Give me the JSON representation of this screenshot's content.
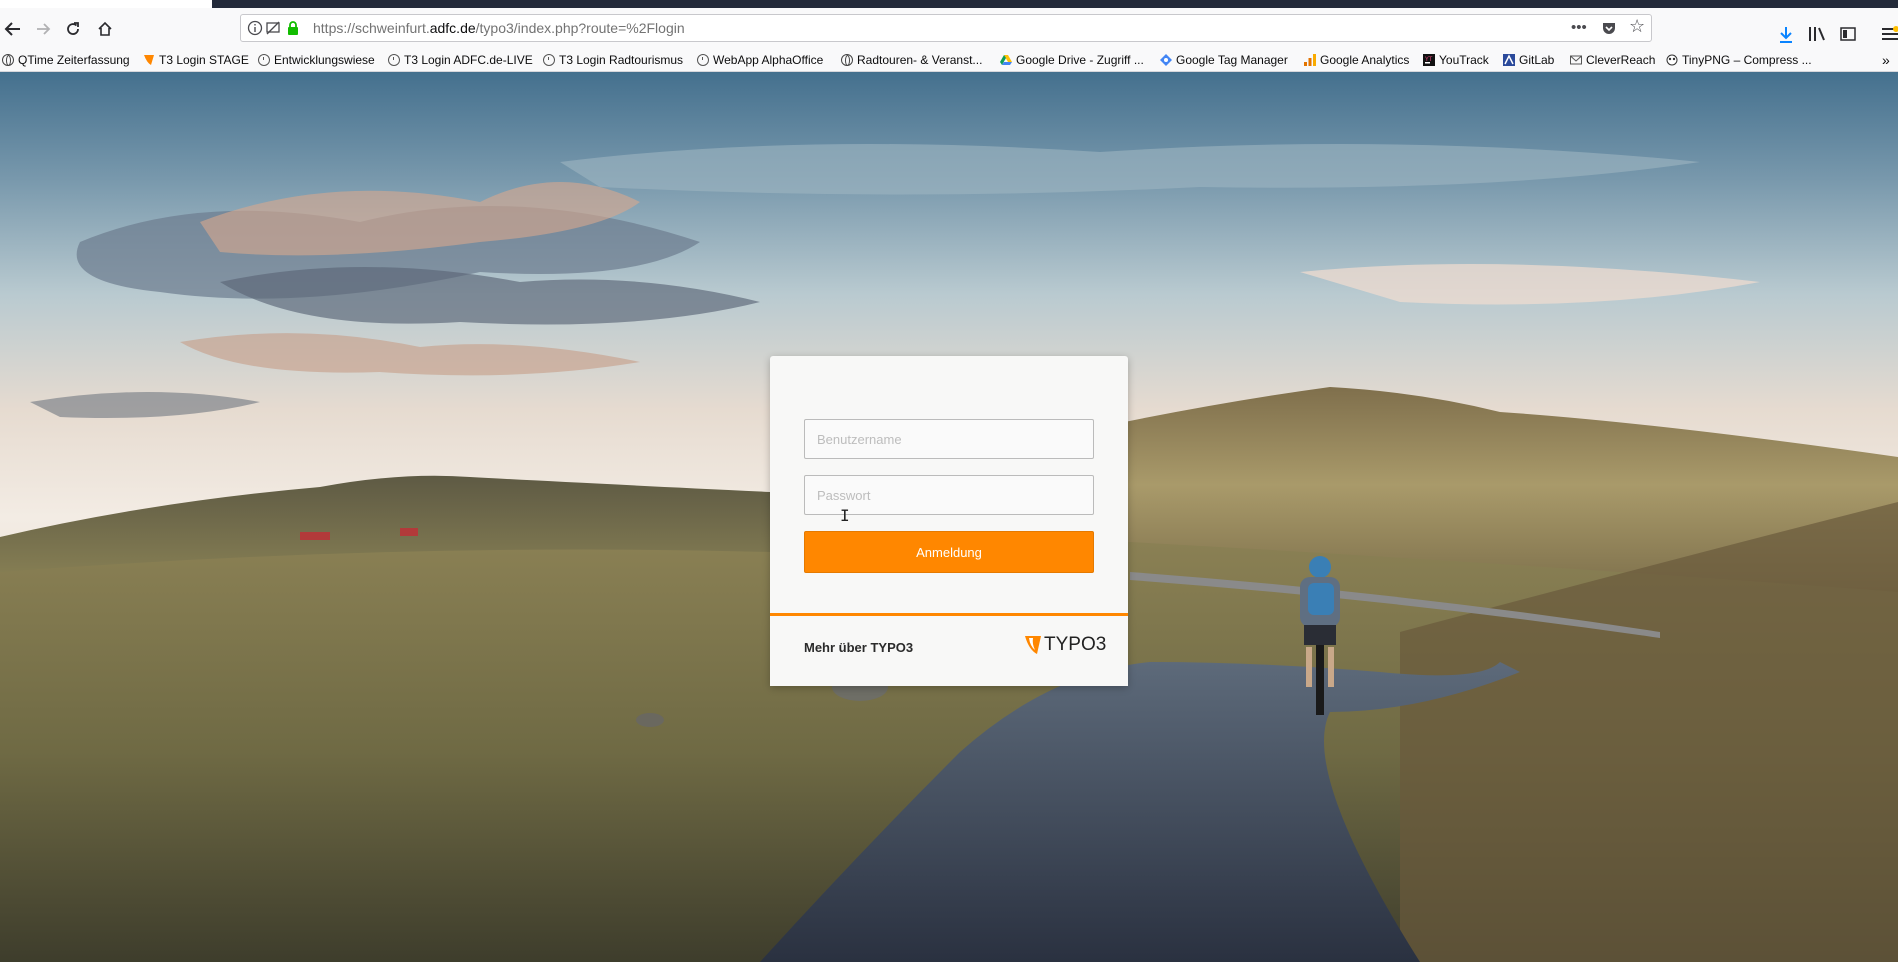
{
  "browser": {
    "url_prefix": "https://schweinfurt.",
    "url_host": "adfc.de",
    "url_path": "/typo3/index.php?route=%2Flogin",
    "more_icon": "•••",
    "pocket_icon": "pocket-icon",
    "star_icon": "☆",
    "back_icon": "back-arrow-icon",
    "forward_icon": "forward-arrow-icon",
    "reload_icon": "reload-icon",
    "home_icon": "home-icon"
  },
  "bookmarks": [
    {
      "label": "QTime Zeiterfassung",
      "icon": "globe"
    },
    {
      "label": "T3 Login STAGE",
      "icon": "typo3"
    },
    {
      "label": "Entwicklungswiese",
      "icon": "clock"
    },
    {
      "label": "T3 Login ADFC.de-LIVE",
      "icon": "clock"
    },
    {
      "label": "T3 Login Radtourismus",
      "icon": "clock"
    },
    {
      "label": "WebApp AlphaOffice",
      "icon": "clock"
    },
    {
      "label": "Radtouren- & Veranst...",
      "icon": "globe"
    },
    {
      "label": "Google Drive - Zugriff ...",
      "icon": "drive"
    },
    {
      "label": "Google Tag Manager",
      "icon": "gtm"
    },
    {
      "label": "Google Analytics",
      "icon": "analytics"
    },
    {
      "label": "YouTrack",
      "icon": "youtrack"
    },
    {
      "label": "GitLab",
      "icon": "gitlab"
    },
    {
      "label": "CleverReach",
      "icon": "mail"
    },
    {
      "label": "TinyPNG – Compress ...",
      "icon": "panda"
    }
  ],
  "login": {
    "username_placeholder": "Benutzername",
    "password_placeholder": "Passwort",
    "submit_label": "Anmeldung",
    "more_link": "Mehr über TYPO3",
    "logo_text": "TYPO3"
  },
  "colors": {
    "accent": "#ff8700",
    "url_text": "#737373"
  }
}
